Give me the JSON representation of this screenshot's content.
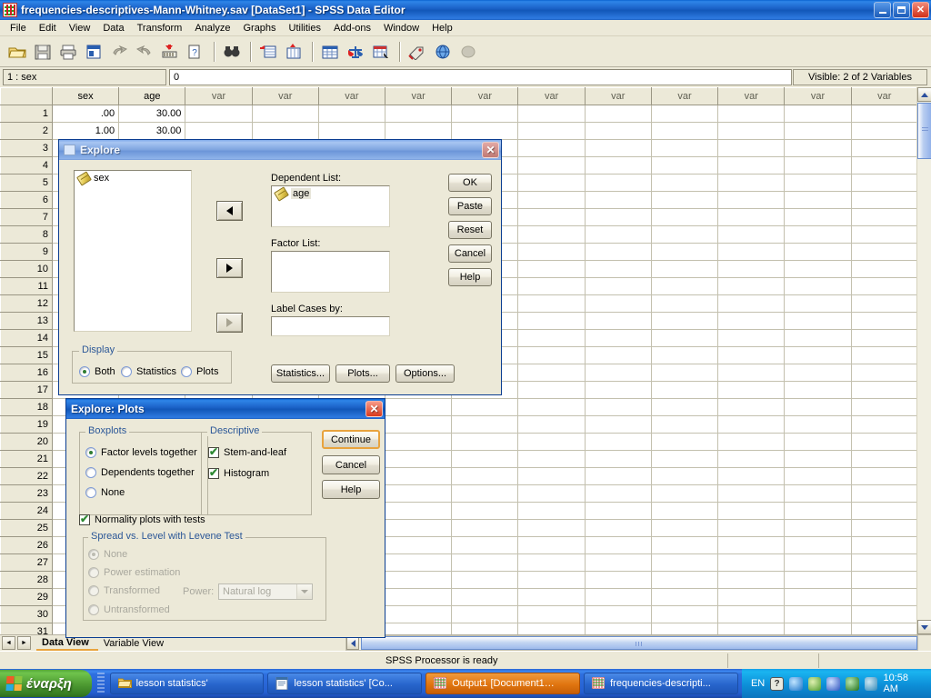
{
  "window": {
    "title": "frequencies-descriptives-Mann-Whitney.sav [DataSet1] - SPSS Data Editor",
    "icon": "spss-app-icon",
    "minimize": "–",
    "maximize": "❐",
    "close": "✕"
  },
  "menu": {
    "items": [
      "File",
      "Edit",
      "View",
      "Data",
      "Transform",
      "Analyze",
      "Graphs",
      "Utilities",
      "Add-ons",
      "Window",
      "Help"
    ]
  },
  "toolbar": {
    "icons": [
      "open-file-icon",
      "save-icon",
      "print-icon",
      "recall-dialogs-icon",
      "undo-icon",
      "redo-icon",
      "goto-case-icon",
      "variables-icon",
      "find-icon",
      "insert-case-icon",
      "insert-variable-icon",
      "split-file-icon",
      "weight-cases-icon",
      "select-cases-icon",
      "value-labels-icon",
      "use-variable-sets-icon",
      "show-all-variables-icon"
    ]
  },
  "cellbar": {
    "cell_ref": "1 : sex",
    "cell_value": "0",
    "visible_vars": "Visible: 2 of 2 Variables"
  },
  "grid": {
    "columns": [
      "sex",
      "age",
      "var",
      "var",
      "var",
      "var",
      "var",
      "var",
      "var",
      "var",
      "var",
      "var",
      "var"
    ],
    "named_count": 2,
    "rows": [
      {
        "n": "1",
        "sex": ".00",
        "age": "30.00"
      },
      {
        "n": "2",
        "sex": "1.00",
        "age": "30.00"
      },
      {
        "n": "3",
        "sex": "",
        "age": ""
      },
      {
        "n": "4",
        "sex": "",
        "age": ""
      },
      {
        "n": "5",
        "sex": "",
        "age": ""
      },
      {
        "n": "6",
        "sex": "",
        "age": ""
      },
      {
        "n": "7",
        "sex": "",
        "age": ""
      },
      {
        "n": "8",
        "sex": "",
        "age": ""
      },
      {
        "n": "9",
        "sex": "",
        "age": ""
      },
      {
        "n": "10",
        "sex": "",
        "age": ""
      },
      {
        "n": "11",
        "sex": "",
        "age": ""
      },
      {
        "n": "12",
        "sex": "",
        "age": ""
      },
      {
        "n": "13",
        "sex": "",
        "age": ""
      },
      {
        "n": "14",
        "sex": "",
        "age": ""
      },
      {
        "n": "15",
        "sex": "",
        "age": ""
      },
      {
        "n": "16",
        "sex": "",
        "age": ""
      },
      {
        "n": "17",
        "sex": "",
        "age": ""
      },
      {
        "n": "18",
        "sex": "",
        "age": ""
      },
      {
        "n": "19",
        "sex": "",
        "age": ""
      },
      {
        "n": "20",
        "sex": "",
        "age": ""
      },
      {
        "n": "21",
        "sex": "",
        "age": ""
      },
      {
        "n": "22",
        "sex": "",
        "age": ""
      },
      {
        "n": "23",
        "sex": "",
        "age": ""
      },
      {
        "n": "24",
        "sex": "",
        "age": ""
      },
      {
        "n": "25",
        "sex": "",
        "age": ""
      },
      {
        "n": "26",
        "sex": "",
        "age": ""
      },
      {
        "n": "27",
        "sex": "",
        "age": ""
      },
      {
        "n": "28",
        "sex": "",
        "age": ""
      },
      {
        "n": "29",
        "sex": "",
        "age": ""
      },
      {
        "n": "30",
        "sex": "",
        "age": ""
      },
      {
        "n": "31",
        "sex": "",
        "age": ""
      }
    ]
  },
  "sheettabs": {
    "data_view": "Data View",
    "variable_view": "Variable View",
    "prev_arrow": "◄",
    "next_arrow": "►"
  },
  "statusbar": {
    "message": "SPSS Processor is ready"
  },
  "explore_dialog": {
    "title": "Explore",
    "close": "✕",
    "source_variables": [
      {
        "label": "sex",
        "icon": "scale-variable-icon"
      }
    ],
    "dependent_list": {
      "label": "Dependent List:",
      "items": [
        {
          "label": "age",
          "icon": "scale-variable-icon"
        }
      ]
    },
    "factor_list": {
      "label": "Factor List:",
      "items": []
    },
    "label_cases_by": {
      "label": "Label Cases by:",
      "value": ""
    },
    "move_buttons": [
      {
        "name": "move-to-dependent-button",
        "direction": "left",
        "enabled": true
      },
      {
        "name": "move-to-factor-button",
        "direction": "right",
        "enabled": true
      },
      {
        "name": "move-to-label-button",
        "direction": "right",
        "enabled": false
      }
    ],
    "display_group": {
      "label": "Display",
      "options": [
        {
          "label": "Both",
          "selected": true
        },
        {
          "label": "Statistics",
          "selected": false
        },
        {
          "label": "Plots",
          "selected": false
        }
      ]
    },
    "action_buttons": [
      "OK",
      "Paste",
      "Reset",
      "Cancel",
      "Help"
    ],
    "sub_buttons": [
      "Statistics...",
      "Plots...",
      "Options..."
    ]
  },
  "plots_dialog": {
    "title": "Explore: Plots",
    "close": "✕",
    "boxplots_group": {
      "label": "Boxplots",
      "options": [
        {
          "label": "Factor levels together",
          "selected": true,
          "enabled": true
        },
        {
          "label": "Dependents together",
          "selected": false,
          "enabled": true
        },
        {
          "label": "None",
          "selected": false,
          "enabled": true
        }
      ]
    },
    "descriptive_group": {
      "label": "Descriptive",
      "options": [
        {
          "label": "Stem-and-leaf",
          "checked": true
        },
        {
          "label": "Histogram",
          "checked": true
        }
      ]
    },
    "normality": {
      "label": "Normality plots with tests",
      "checked": true
    },
    "spread_group": {
      "label": "Spread vs. Level with Levene Test",
      "options": [
        {
          "label": "None",
          "selected": true,
          "enabled": false
        },
        {
          "label": "Power estimation",
          "selected": false,
          "enabled": false
        },
        {
          "label": "Transformed",
          "selected": false,
          "enabled": false
        },
        {
          "label": "Untransformed",
          "selected": false,
          "enabled": false
        }
      ],
      "power_label": "Power:",
      "power_value": "Natural log"
    },
    "action_buttons": [
      "Continue",
      "Cancel",
      "Help"
    ]
  },
  "taskbar": {
    "start_label": "έναρξη",
    "items": [
      {
        "label": "lesson statistics'",
        "icon": "folder-icon",
        "active": false
      },
      {
        "label": "lesson statistics' [Co...",
        "icon": "word-document-icon",
        "active": false
      },
      {
        "label": "Output1 [Document1…",
        "icon": "spss-output-icon",
        "active": true
      },
      {
        "label": "frequencies-descripti...",
        "icon": "spss-app-icon",
        "active": false
      }
    ],
    "tray": {
      "language": "EN",
      "icons": [
        "help-icon",
        "volume-icon",
        "shield-icon",
        "network-icon",
        "antivirus-icon",
        "update-icon"
      ],
      "clock": "10:58 AM"
    }
  }
}
